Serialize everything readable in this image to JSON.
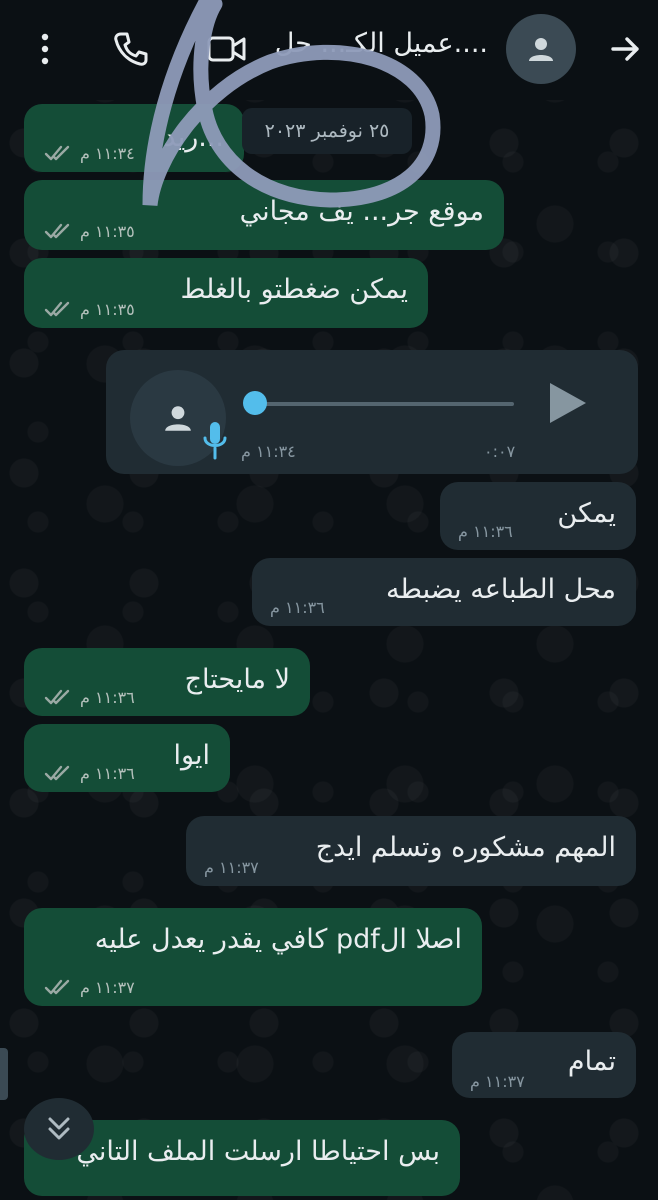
{
  "header": {
    "contact_name": "عميل الكـ... حل....",
    "icons": [
      "back-arrow-icon",
      "avatar-person-icon",
      "video-call-icon",
      "voice-call-icon",
      "more-vertical-icon"
    ]
  },
  "date_chip": "٢٥ نوفمبر ٢٠٢٣",
  "messages": [
    {
      "dir": "out",
      "text": "...ريد",
      "time": "١١:٣٤ م",
      "status": "read"
    },
    {
      "dir": "out",
      "text": "موقع جر... يف مجاني",
      "time": "١١:٣٥ م",
      "status": "read"
    },
    {
      "dir": "out",
      "text": "يمكن ضغطتو بالغلط",
      "time": "١١:٣٥ م",
      "status": "read"
    },
    {
      "dir": "in",
      "type": "voice",
      "duration": "٠:٠٧",
      "time": "١١:٣٤ م",
      "progress": 0
    },
    {
      "dir": "in",
      "text": "يمكن",
      "time": "١١:٣٦ م"
    },
    {
      "dir": "in",
      "text": "محل الطباعه يضبطه",
      "time": "١١:٣٦ م"
    },
    {
      "dir": "out",
      "text": "لا مايحتاج",
      "time": "١١:٣٦ م",
      "status": "read"
    },
    {
      "dir": "out",
      "text": "ايوا",
      "time": "١١:٣٦ م",
      "status": "read"
    },
    {
      "dir": "in",
      "text": "المهم مشكوره وتسلم ايدج",
      "time": "١١:٣٧ م"
    },
    {
      "dir": "out",
      "text": "اصلا الpdf كافي يقدر يعدل عليه",
      "time": "١١:٣٧ م",
      "status": "read"
    },
    {
      "dir": "in",
      "text": "تمام",
      "time": "١١:٣٧ م"
    },
    {
      "dir": "out",
      "text": "بس احتياطا ارسلت الملف التاني",
      "time": "",
      "status": ""
    }
  ],
  "colors": {
    "background": "#0b1014",
    "outgoing_bubble": "#144d37",
    "incoming_bubble": "#202c33",
    "accent_blue": "#53bdeb"
  }
}
